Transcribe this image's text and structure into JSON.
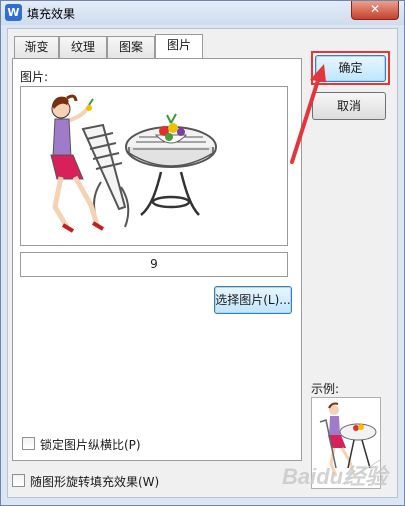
{
  "window": {
    "title": "填充效果",
    "app_icon_letter": "W",
    "close_glyph": "✕"
  },
  "tabs": [
    {
      "label": "渐变",
      "active": false
    },
    {
      "label": "纹理",
      "active": false
    },
    {
      "label": "图案",
      "active": false
    },
    {
      "label": "图片",
      "active": true
    }
  ],
  "picture_panel": {
    "picture_label": "图片:",
    "file_name": "9",
    "select_picture_label": "选择图片(L)...",
    "lock_aspect_label": "锁定图片纵横比(P)",
    "lock_aspect_checked": false
  },
  "rotate_with_shape_label": "随图形旋转填充效果(W)",
  "rotate_with_shape_checked": false,
  "buttons": {
    "ok_label": "确定",
    "cancel_label": "取消"
  },
  "sample_label": "示例:",
  "watermark_text": "Baidu经验",
  "colors": {
    "highlight": "#e2363b",
    "focus_border": "#3c7fb1",
    "title_bg": "#dce6f3"
  },
  "icons": [
    "app-icon",
    "close-icon",
    "picture-illustration",
    "arrow-annotation"
  ]
}
